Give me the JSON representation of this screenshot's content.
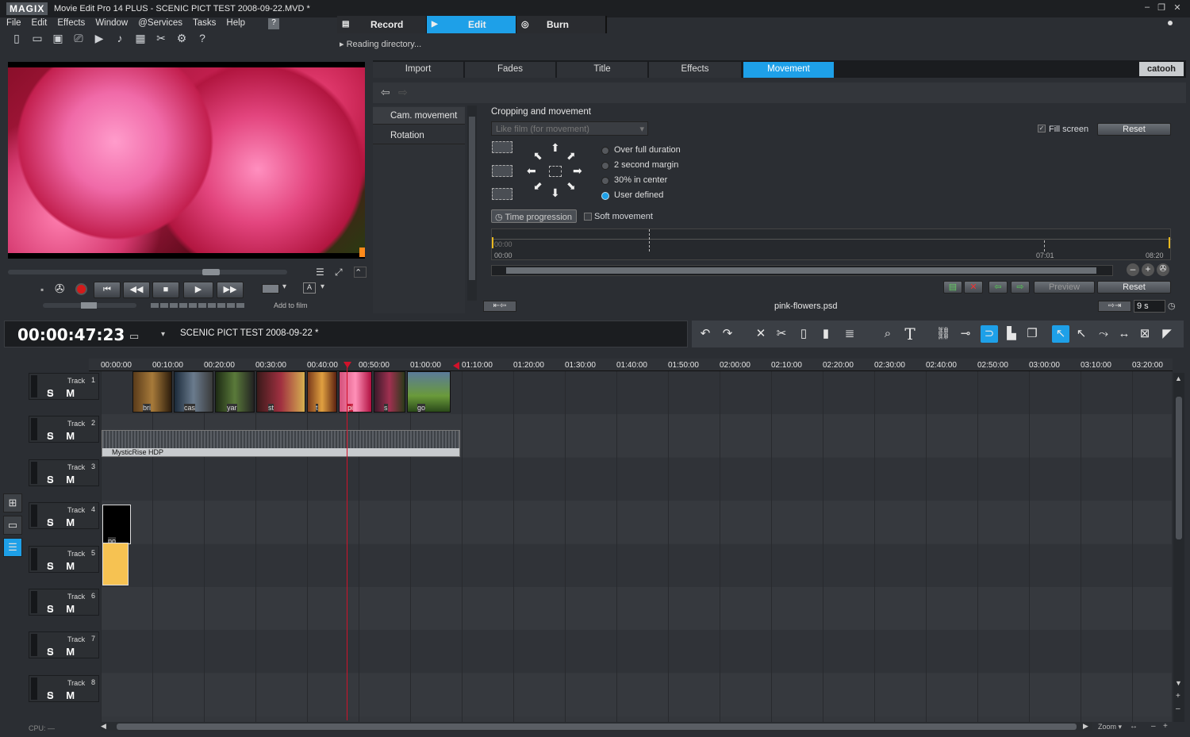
{
  "app": {
    "logo": "MAGIX",
    "title": "Movie Edit Pro 14 PLUS - SCENIC PICT TEST 2008-09-22.MVD *"
  },
  "menu": [
    "File",
    "Edit",
    "Effects",
    "Window",
    "@Services",
    "Tasks",
    "Help"
  ],
  "modes": {
    "record": "Record",
    "edit": "Edit",
    "burn": "Burn"
  },
  "status": "Reading directory...",
  "media_tabs": [
    "Import",
    "Fades",
    "Title",
    "Effects",
    "Movement"
  ],
  "brand_badge": "catooh",
  "left_list": [
    "Cam. movement",
    "Rotation"
  ],
  "movement": {
    "section_title": "Cropping and movement",
    "preset_placeholder": "Like film (for movement)",
    "fill_screen": "Fill screen",
    "reset": "Reset",
    "options": [
      "Over full duration",
      "2 second margin",
      "30% in center",
      "User defined"
    ],
    "selected_option": "User defined",
    "time_progression": "Time progression",
    "soft_movement": "Soft movement",
    "timeline_ticks": [
      "00:00",
      "07:01",
      "08:20"
    ],
    "timeline_start": "00:00",
    "preview": "Preview",
    "reset2": "Reset",
    "filename": "pink-flowers.psd",
    "duration": "9 s"
  },
  "player": {
    "add_to_film": "Add to film"
  },
  "timeline": {
    "timecode": "00:00:47:23",
    "project": "SCENIC PICT TEST 2008-09-22 *",
    "ruler": [
      "00:00:00",
      "00:10:00",
      "00:20:00",
      "00:30:00",
      "00:40:00",
      "00:50:00",
      "01:00:00",
      "01:10:00",
      "01:20:00",
      "01:30:00",
      "01:40:00",
      "01:50:00",
      "02:00:00",
      "02:10:00",
      "02:20:00",
      "02:30:00",
      "02:40:00",
      "02:50:00",
      "03:00:00",
      "03:10:00",
      "03:20:00"
    ],
    "tracks": [
      {
        "label": "Track",
        "num": "1"
      },
      {
        "label": "Track",
        "num": "2"
      },
      {
        "label": "Track",
        "num": "3"
      },
      {
        "label": "Track",
        "num": "4"
      },
      {
        "label": "Track",
        "num": "5"
      },
      {
        "label": "Track",
        "num": "6"
      },
      {
        "label": "Track",
        "num": "7"
      },
      {
        "label": "Track",
        "num": "8"
      }
    ],
    "track_sm": "S M",
    "clip_labels": [
      "bri",
      "cas",
      "yar",
      "st",
      "t",
      "pi",
      "s",
      "go"
    ],
    "audio_clip": "MysticRise HDP",
    "track4_clip": "po",
    "cpu": "CPU:",
    "zoom": "Zoom"
  },
  "colors": {
    "accent": "#1e9ee6",
    "playhead": "#d1122a",
    "tab_active": "#1ea0e8"
  }
}
